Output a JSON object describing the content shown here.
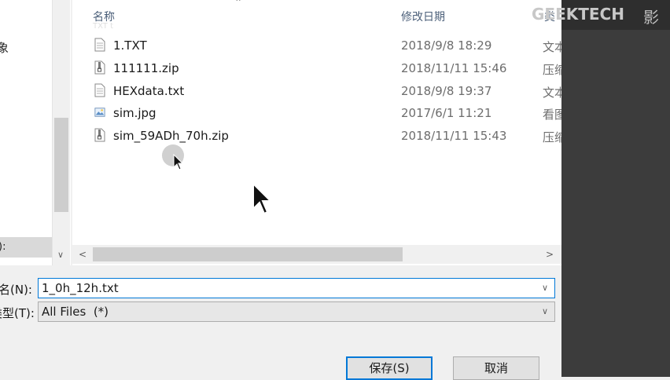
{
  "nav": {
    "partial_item": "象",
    "selected_partial": "):"
  },
  "columns": {
    "name": "名称",
    "date": "修改日期",
    "type_partial": "类"
  },
  "header_ghost": "TXT t",
  "files": [
    {
      "name": "1.TXT",
      "date": "2018/9/8 18:29",
      "type": "文本",
      "icon": "text-file-icon"
    },
    {
      "name": "111111.zip",
      "date": "2018/11/11 15:46",
      "type": "压缩",
      "icon": "zip-file-icon"
    },
    {
      "name": "HEXdata.txt",
      "date": "2018/9/8 19:37",
      "type": "文本",
      "icon": "text-file-icon"
    },
    {
      "name": "sim.jpg",
      "date": "2017/6/1 11:21",
      "type": "看图",
      "icon": "image-file-icon"
    },
    {
      "name": "sim_59ADh_70h.zip",
      "date": "2018/11/11 15:43",
      "type": "压缩",
      "icon": "zip-file-icon"
    }
  ],
  "form": {
    "filename_label": "名(N):",
    "filename_value": "1_0h_12h.txt",
    "filetype_label": "类型(T):",
    "filetype_value": "All Files  (*)"
  },
  "buttons": {
    "save": "保存(S)",
    "cancel": "取消"
  },
  "watermark": {
    "text": "GEEKTECH",
    "extra": "影"
  },
  "colors": {
    "accent": "#0078d7",
    "dark_panel": "#3c3c3c"
  }
}
